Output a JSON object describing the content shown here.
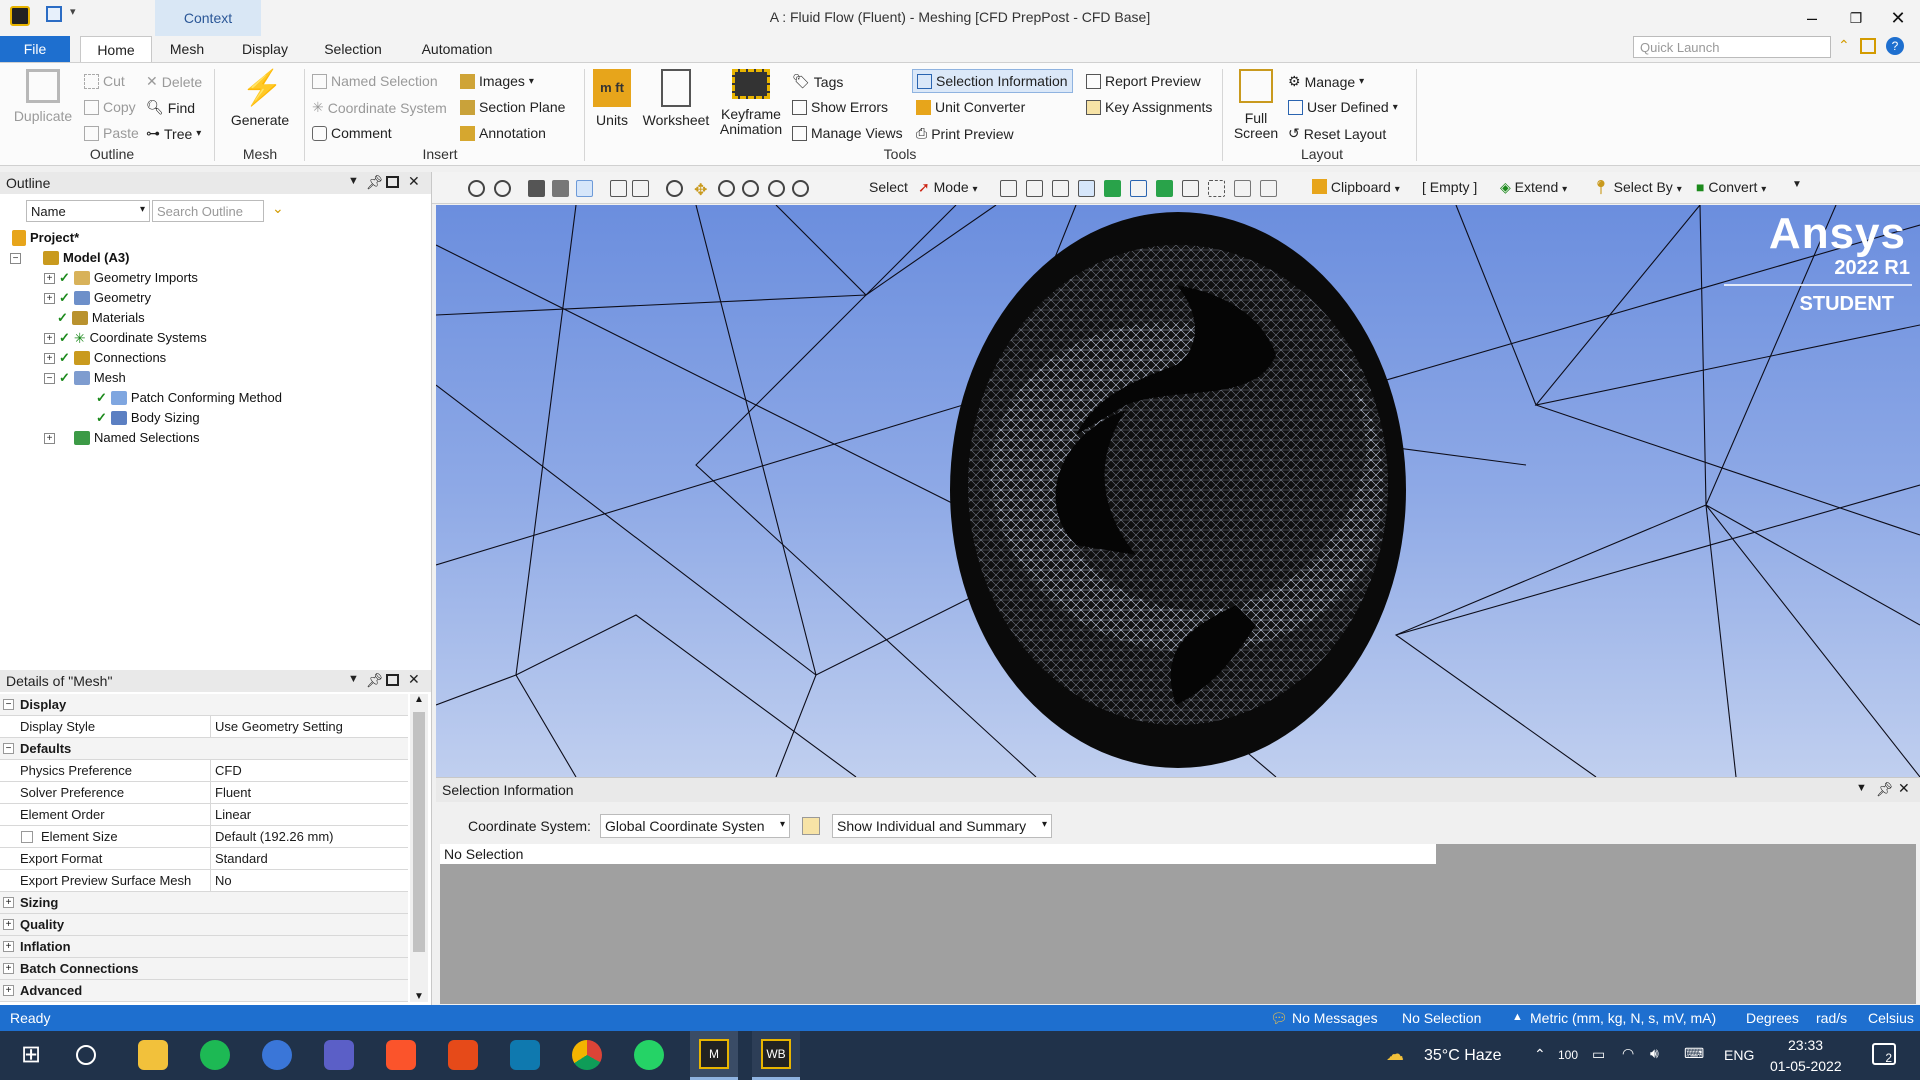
{
  "window": {
    "title": "A : Fluid Flow (Fluent) - Meshing [CFD PrepPost - CFD Base]",
    "context_tab": "Context",
    "quick_launch_placeholder": "Quick Launch"
  },
  "tabs": [
    "File",
    "Home",
    "Mesh",
    "Display",
    "Selection",
    "Automation"
  ],
  "ribbon": {
    "outline_group": {
      "label": "Outline",
      "duplicate": "Duplicate",
      "cut": "Cut",
      "copy": "Copy",
      "paste": "Paste",
      "delete": "Delete",
      "find": "Find",
      "tree": "Tree"
    },
    "mesh_group": {
      "label": "Mesh",
      "generate": "Generate"
    },
    "insert_group": {
      "label": "Insert",
      "named_selection": "Named Selection",
      "coordinate_system": "Coordinate System",
      "comment": "Comment",
      "images": "Images",
      "section_plane": "Section Plane",
      "annotation": "Annotation"
    },
    "tools_group": {
      "label": "Tools",
      "units": "Units",
      "worksheet": "Worksheet",
      "keyframe": "Keyframe",
      "animation": "Animation",
      "tags": "Tags",
      "show_errors": "Show Errors",
      "manage_views": "Manage Views",
      "selection_information": "Selection Information",
      "unit_converter": "Unit Converter",
      "print_preview": "Print Preview",
      "report_preview": "Report Preview",
      "key_assignments": "Key Assignments"
    },
    "layout_group": {
      "label": "Layout",
      "full": "Full",
      "screen": "Screen",
      "manage": "Manage",
      "user_defined": "User Defined",
      "reset_layout": "Reset Layout"
    }
  },
  "outline": {
    "title": "Outline",
    "name_filter": "Name",
    "search_placeholder": "Search Outline",
    "tree": [
      {
        "label": "Project*"
      },
      {
        "label": "Model (A3)"
      },
      {
        "label": "Geometry Imports"
      },
      {
        "label": "Geometry"
      },
      {
        "label": "Materials"
      },
      {
        "label": "Coordinate Systems"
      },
      {
        "label": "Connections"
      },
      {
        "label": "Mesh"
      },
      {
        "label": "Patch Conforming Method"
      },
      {
        "label": "Body Sizing"
      },
      {
        "label": "Named Selections"
      }
    ]
  },
  "details": {
    "title": "Details of \"Mesh\"",
    "rows": [
      {
        "key": "Display",
        "value": ""
      },
      {
        "key": "Display Style",
        "value": "Use Geometry Setting"
      },
      {
        "key": "Defaults",
        "value": ""
      },
      {
        "key": "Physics Preference",
        "value": "CFD"
      },
      {
        "key": "Solver Preference",
        "value": "Fluent"
      },
      {
        "key": "Element Order",
        "value": "Linear"
      },
      {
        "key": "Element Size",
        "value": "Default (192.26 mm)"
      },
      {
        "key": "Export Format",
        "value": "Standard"
      },
      {
        "key": "Export Preview Surface Mesh",
        "value": "No"
      },
      {
        "key": "Sizing",
        "value": ""
      },
      {
        "key": "Quality",
        "value": ""
      },
      {
        "key": "Inflation",
        "value": ""
      },
      {
        "key": "Batch Connections",
        "value": ""
      },
      {
        "key": "Advanced",
        "value": ""
      }
    ]
  },
  "graphics_toolbar": {
    "select": "Select",
    "mode": "Mode",
    "clipboard": "Clipboard",
    "empty": "[ Empty ]",
    "extend": "Extend",
    "select_by": "Select By",
    "convert": "Convert"
  },
  "viewport": {
    "brand": "Ansys",
    "version": "2022 R1",
    "edition": "STUDENT"
  },
  "selection_info": {
    "title": "Selection Information",
    "coord_label": "Coordinate System:",
    "coord_value": "Global Coordinate Systen",
    "show_value": "Show Individual and Summary",
    "no_selection": "No Selection"
  },
  "status": {
    "ready": "Ready",
    "messages": "No Messages",
    "selection": "No Selection",
    "units": "Metric (mm, kg, N, s, mV, mA)",
    "angle": "Degrees",
    "rate": "rad/s",
    "temp": "Celsius"
  },
  "taskbar": {
    "weather": "35°C  Haze",
    "battery": "100",
    "lang": "ENG",
    "time": "23:33",
    "date": "01-05-2022",
    "notif": "2",
    "app_m": "M",
    "app_wb": "WB"
  },
  "colors": {
    "accent": "#1e6fcf",
    "taskbar": "#20324a",
    "viewport_top": "#6b8ede"
  }
}
